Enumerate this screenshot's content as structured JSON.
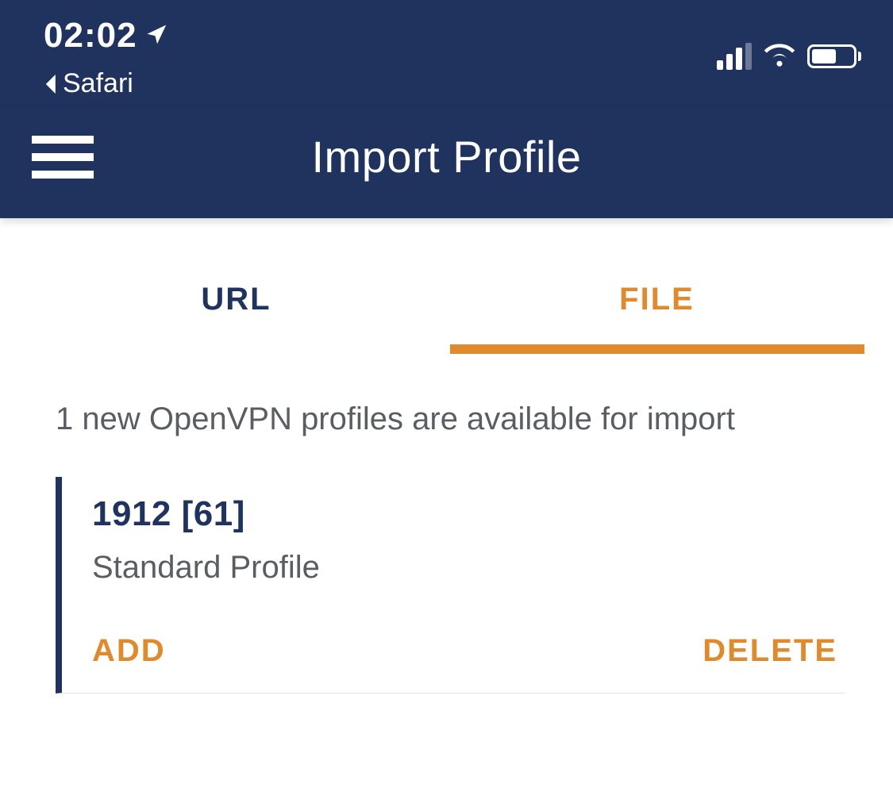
{
  "status_bar": {
    "time": "02:02",
    "back_app": "Safari"
  },
  "header": {
    "title": "Import Profile"
  },
  "tabs": {
    "url": "URL",
    "file": "FILE"
  },
  "info_message": "1 new OpenVPN profiles are available for import",
  "profile": {
    "name": "1912 [61]",
    "type": "Standard Profile",
    "add_label": "ADD",
    "delete_label": "DELETE"
  },
  "colors": {
    "navy": "#1f335e",
    "orange": "#e08a2e",
    "grey_text": "#5a5e63"
  }
}
